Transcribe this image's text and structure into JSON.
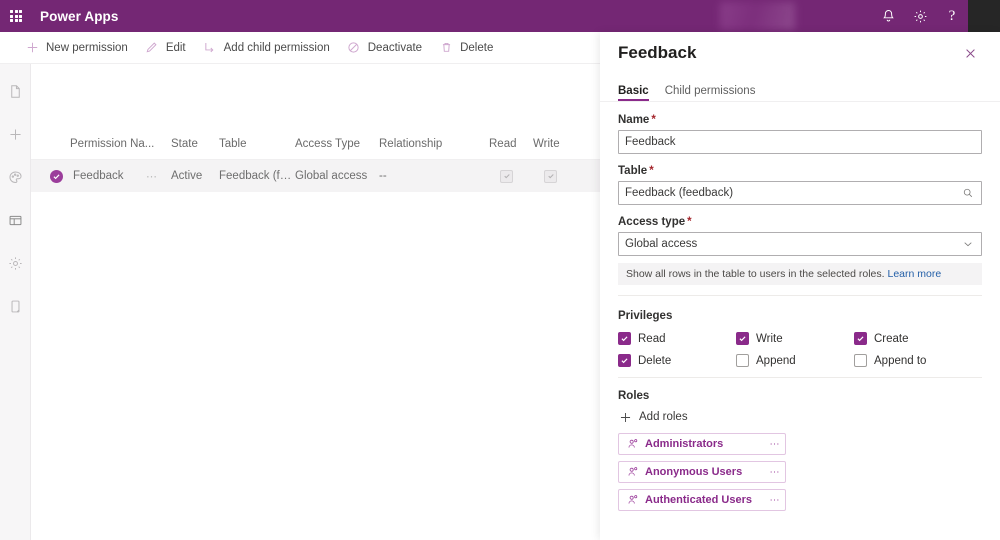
{
  "topbar": {
    "waffle_label": "App launcher",
    "brand": "Power Apps",
    "icons": [
      "bell-icon",
      "gear-icon",
      "help-icon"
    ],
    "help_glyph": "?"
  },
  "command_bar": {
    "items": [
      {
        "label": "New permission",
        "icon": "plus-icon"
      },
      {
        "label": "Edit",
        "icon": "pencil-icon"
      },
      {
        "label": "Add child permission",
        "icon": "add-child-icon"
      },
      {
        "label": "Deactivate",
        "icon": "block-icon"
      },
      {
        "label": "Delete",
        "icon": "trash-icon"
      }
    ]
  },
  "rail": {
    "items": [
      {
        "name": "pages-icon"
      },
      {
        "name": "plus-icon"
      },
      {
        "name": "theme-palette-icon"
      },
      {
        "name": "components-icon"
      },
      {
        "name": "settings-gear-icon"
      },
      {
        "name": "device-preview-icon"
      }
    ]
  },
  "grid": {
    "columns": [
      "Permission Na...",
      "State",
      "Table",
      "Access Type",
      "Relationship",
      "Read",
      "Write"
    ],
    "rows": [
      {
        "name": "Feedback",
        "state": "Active",
        "table": "Feedback (feedback)",
        "access_type": "Global access",
        "relationship": "--",
        "read": true,
        "write": true
      }
    ]
  },
  "panel": {
    "title": "Feedback",
    "close_label": "Close",
    "tabs": [
      {
        "label": "Basic",
        "selected": true
      },
      {
        "label": "Child permissions",
        "selected": false
      }
    ],
    "fields": {
      "name_label": "Name",
      "name_value": "Feedback",
      "table_label": "Table",
      "table_value": "Feedback (feedback)",
      "access_type_label": "Access type",
      "access_type_value": "Global access",
      "required_marker": "*"
    },
    "info": {
      "text": "Show all rows in the table to users in the selected roles.",
      "link": "Learn more"
    },
    "privileges": {
      "title": "Privileges",
      "items": [
        {
          "label": "Read",
          "checked": true
        },
        {
          "label": "Write",
          "checked": true
        },
        {
          "label": "Create",
          "checked": true
        },
        {
          "label": "Delete",
          "checked": true
        },
        {
          "label": "Append",
          "checked": false
        },
        {
          "label": "Append to",
          "checked": false
        }
      ]
    },
    "roles": {
      "title": "Roles",
      "add_label": "Add roles",
      "items": [
        {
          "name": "Administrators"
        },
        {
          "name": "Anonymous Users"
        },
        {
          "name": "Authenticated Users"
        }
      ]
    }
  },
  "colors": {
    "brand_purple": "#742774",
    "accent_purple": "#8a2a8a",
    "link_blue": "#2560a8",
    "required_red": "#a4262c"
  }
}
